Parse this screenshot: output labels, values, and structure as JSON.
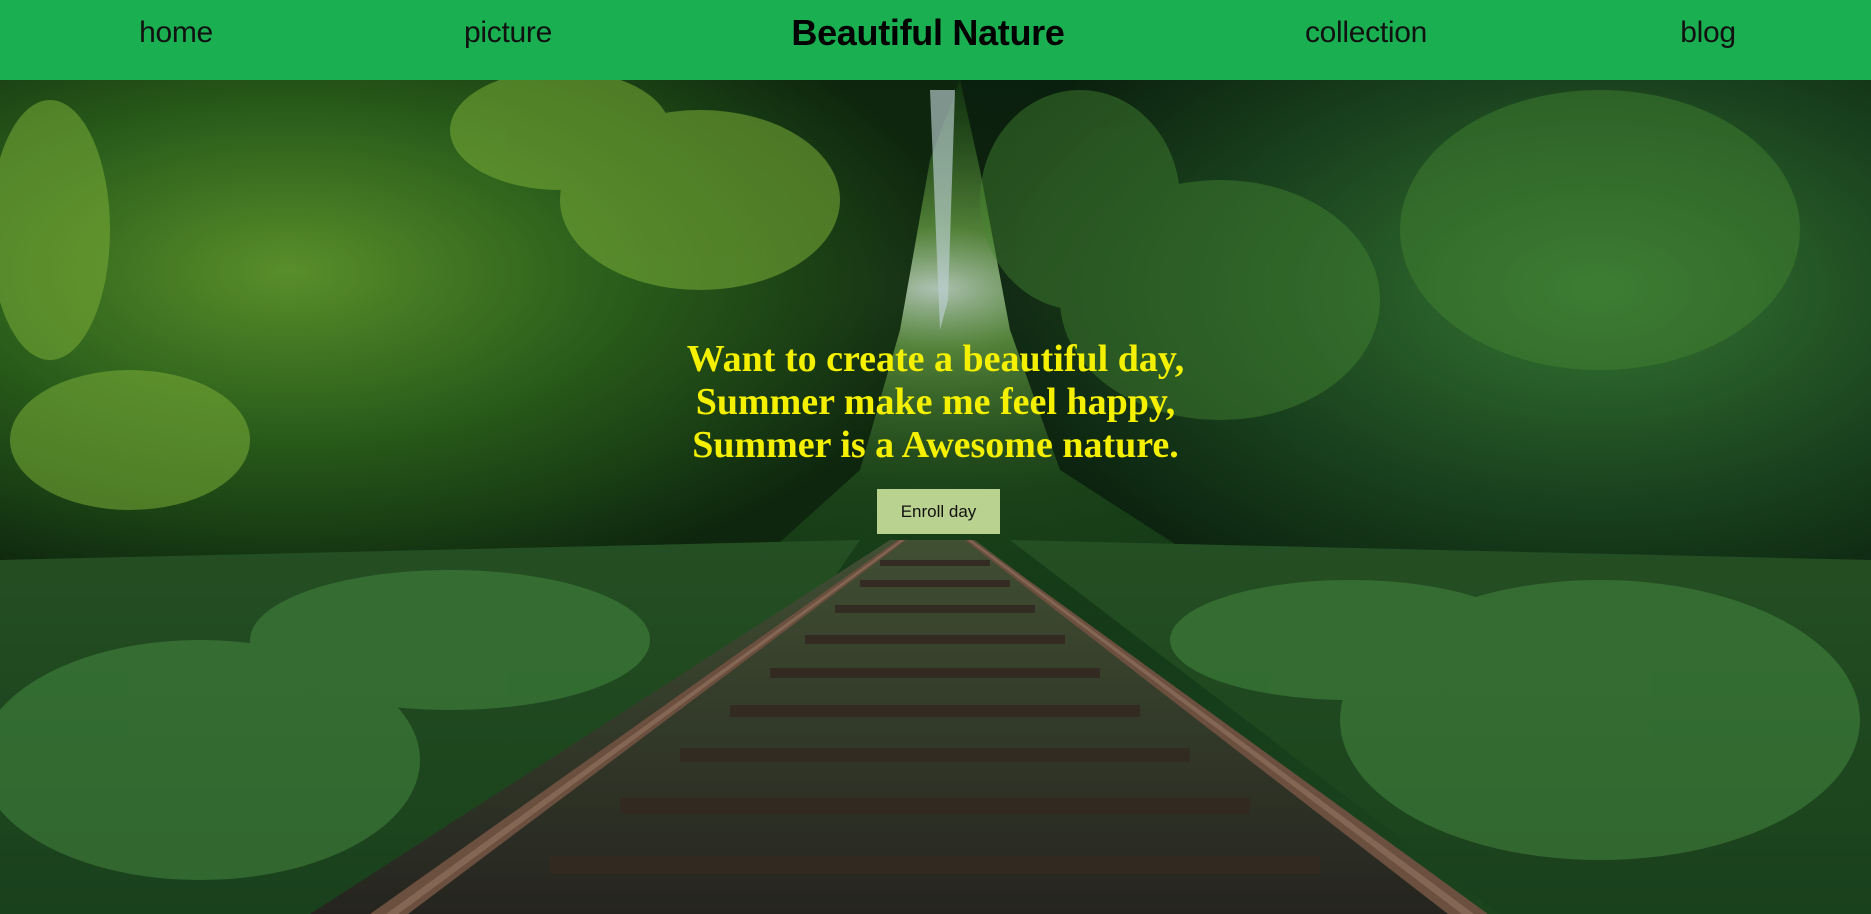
{
  "nav": {
    "items": [
      {
        "label": "home"
      },
      {
        "label": "picture"
      },
      {
        "label": "Beautiful Nature"
      },
      {
        "label": "collection"
      },
      {
        "label": "blog"
      }
    ]
  },
  "hero": {
    "lines": [
      "Want to create a beautiful day,",
      "Summer make me feel happy,",
      "Summer is a Awesome nature."
    ],
    "button_label": "Enroll day",
    "image": "forest railway track",
    "text_color": "#f4f000"
  },
  "colors": {
    "nav_background": "#1aaf50",
    "button_background": "#b9d28f"
  }
}
